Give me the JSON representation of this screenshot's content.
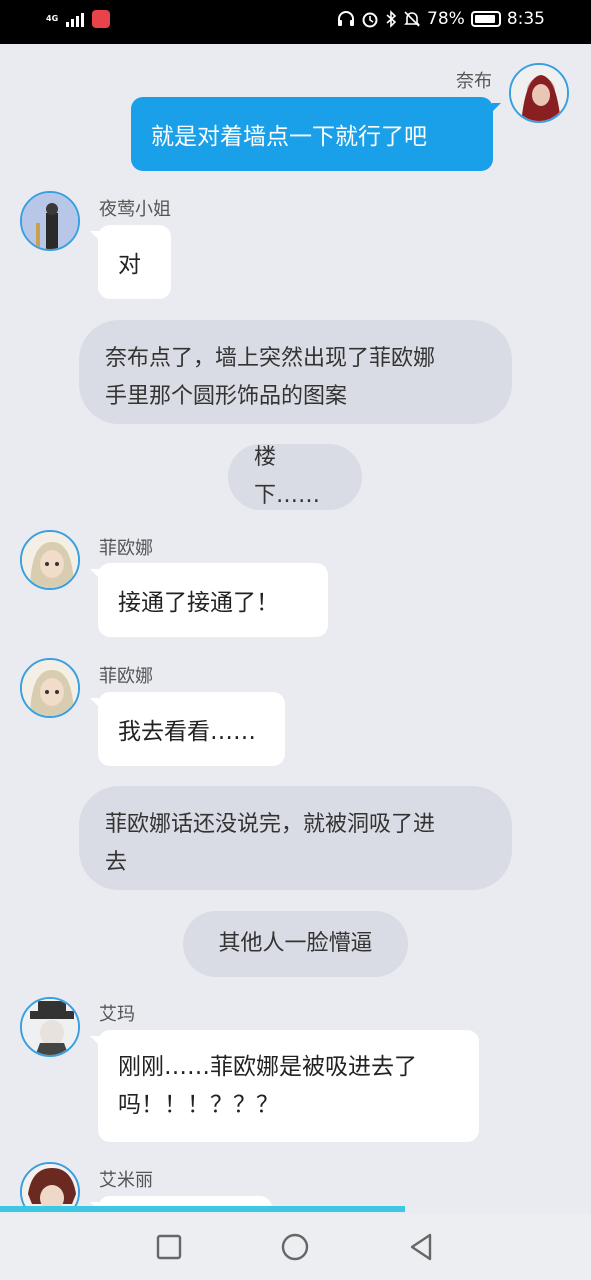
{
  "status_bar": {
    "network": "4G",
    "battery": "78%",
    "time": "8:35",
    "icons": [
      "headphones-icon",
      "alarm-icon",
      "bluetooth-icon",
      "mute-icon",
      "battery-icon"
    ]
  },
  "messages": [
    {
      "type": "right",
      "speaker": "奈布",
      "text": "就是对着墙点一下就行了吧",
      "avatar": "nabe-avatar"
    },
    {
      "type": "left",
      "speaker": "夜莺小姐",
      "text": "对",
      "avatar": "nightingale-avatar"
    },
    {
      "type": "narration",
      "lines": [
        "奈布点了，墙上突然出现了菲欧娜",
        "手里那个圆形饰品的图案"
      ]
    },
    {
      "type": "narration",
      "lines": [
        "楼下……"
      ]
    },
    {
      "type": "left",
      "speaker": "菲欧娜",
      "text": "接通了接通了！",
      "avatar": "fiona-avatar"
    },
    {
      "type": "left",
      "speaker": "菲欧娜",
      "text": "我去看看……",
      "avatar": "fiona-avatar"
    },
    {
      "type": "narration",
      "lines": [
        "菲欧娜话还没说完，就被洞吸了进",
        "去"
      ]
    },
    {
      "type": "narration",
      "lines": [
        "其他人一脸懵逼"
      ]
    },
    {
      "type": "left",
      "speaker": "艾玛",
      "lines": [
        "刚刚……菲欧娜是被吸进去了",
        "吗！！！？？？"
      ],
      "avatar": "emma-avatar"
    },
    {
      "type": "left",
      "speaker": "艾米丽",
      "text": "",
      "avatar": "emily-avatar"
    }
  ],
  "progress": {
    "fraction": 0.685
  },
  "nav": [
    "recent-apps-button",
    "home-button",
    "back-button"
  ],
  "colors": {
    "accent": "#1aa0e8",
    "background": "#e9ebf0",
    "narration": "#d9dce4",
    "progress": "#3ec7e3"
  }
}
